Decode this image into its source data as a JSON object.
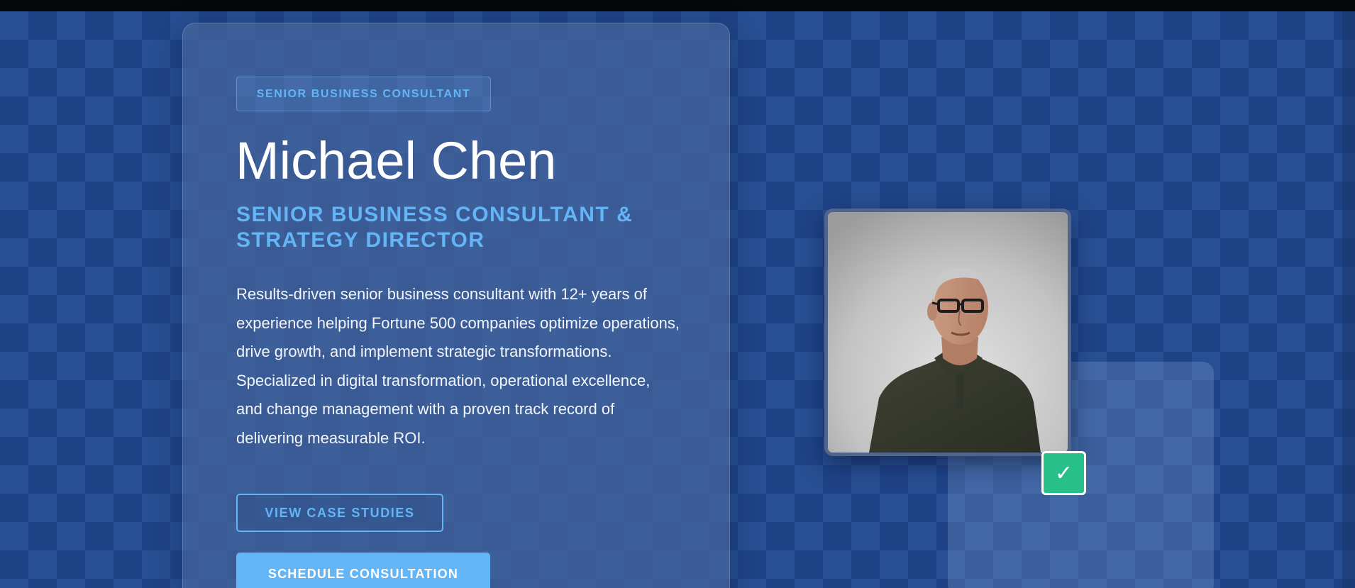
{
  "profile": {
    "badge_label": "SENIOR BUSINESS CONSULTANT",
    "name": "Michael Chen",
    "subtitle": "SENIOR BUSINESS CONSULTANT & STRATEGY DIRECTOR",
    "bio": "Results-driven senior business consultant with 12+ years of experience helping Fortune 500 companies optimize operations, drive growth, and implement strategic transformations. Specialized in digital transformation, operational excellence, and change management with a proven track record of delivering measurable ROI."
  },
  "actions": {
    "case_studies_label": "VIEW CASE STUDIES",
    "consultation_label": "SCHEDULE CONSULTATION"
  },
  "photo": {
    "verified_icon": "check-icon",
    "verified_glyph": "✓"
  },
  "colors": {
    "accent": "#64b5f6",
    "verified": "#27c08a",
    "background": "#244c8f"
  }
}
